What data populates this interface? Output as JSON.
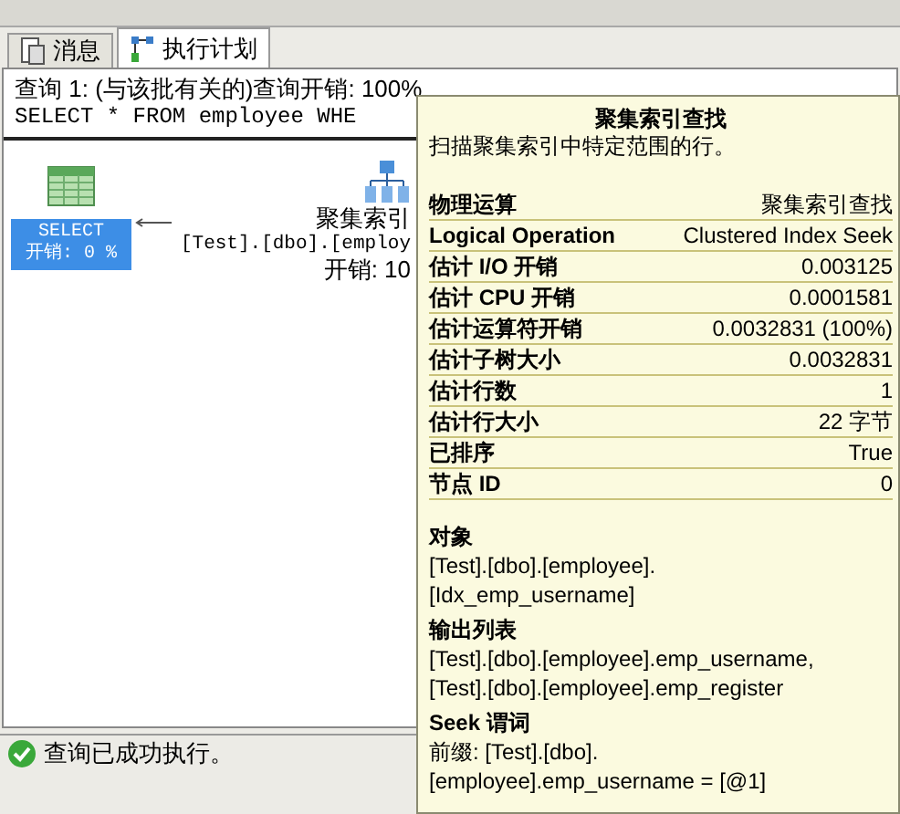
{
  "tabs": [
    {
      "label": "消息",
      "kind": "messages",
      "selected": false
    },
    {
      "label": "执行计划",
      "kind": "plan",
      "selected": true
    }
  ],
  "query_header": "查询 1: (与该批有关的)查询开销: 100%",
  "query_text": "SELECT * FROM employee WHE",
  "plan_nodes": [
    {
      "kind": "select",
      "name": "SELECT",
      "cost": "开销: 0 %",
      "selected": true
    },
    {
      "kind": "index_seek",
      "name": "聚集索引",
      "object": "[Test].[dbo].[employ",
      "cost": "开销: 10",
      "selected": false
    }
  ],
  "tooltip": {
    "title": "聚集索引查找",
    "description": "扫描聚集索引中特定范围的行。",
    "properties": [
      {
        "label": "物理运算",
        "value": "聚集索引查找"
      },
      {
        "label": "Logical Operation",
        "value": "Clustered Index Seek"
      },
      {
        "label": "估计 I/O 开销",
        "value": "0.003125"
      },
      {
        "label": "估计 CPU 开销",
        "value": "0.0001581"
      },
      {
        "label": "估计运算符开销",
        "value": "0.0032831 (100%)"
      },
      {
        "label": "估计子树大小",
        "value": "0.0032831"
      },
      {
        "label": "估计行数",
        "value": "1"
      },
      {
        "label": "估计行大小",
        "value": "22 字节"
      },
      {
        "label": "已排序",
        "value": "True"
      },
      {
        "label": "节点 ID",
        "value": "0"
      }
    ],
    "sections": [
      {
        "heading": "对象",
        "lines": [
          "[Test].[dbo].[employee].",
          "[Idx_emp_username]"
        ]
      },
      {
        "heading": "输出列表",
        "lines": [
          "[Test].[dbo].[employee].emp_username,",
          "[Test].[dbo].[employee].emp_register"
        ]
      },
      {
        "heading": "Seek 谓词",
        "lines": [
          "前缀: [Test].[dbo].",
          "[employee].emp_username = [@1]"
        ]
      }
    ]
  },
  "status_bar": {
    "message": "查询已成功执行。"
  }
}
